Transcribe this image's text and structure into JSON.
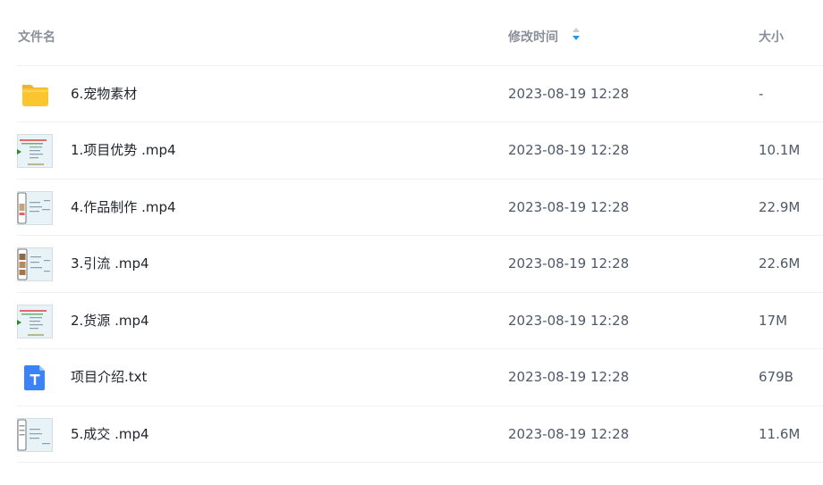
{
  "header": {
    "name_label": "文件名",
    "time_label": "修改时间",
    "size_label": "大小",
    "sort_icon": "sort-icon"
  },
  "colors": {
    "folder": "#fbc531",
    "text_icon": "#3b82f6",
    "sort_active": "#2196f3",
    "divider": "#eef0f3"
  },
  "files": [
    {
      "name": "6.宠物素材",
      "modified": "2023-08-19 12:28",
      "size": "-",
      "icon": "folder-icon"
    },
    {
      "name": "1.项目优势 .mp4",
      "modified": "2023-08-19 12:28",
      "size": "10.1M",
      "icon": "video-thumbnail"
    },
    {
      "name": "4.作品制作 .mp4",
      "modified": "2023-08-19 12:28",
      "size": "22.9M",
      "icon": "video-thumbnail"
    },
    {
      "name": "3.引流 .mp4",
      "modified": "2023-08-19 12:28",
      "size": "22.6M",
      "icon": "video-thumbnail"
    },
    {
      "name": "2.货源 .mp4",
      "modified": "2023-08-19 12:28",
      "size": "17M",
      "icon": "video-thumbnail"
    },
    {
      "name": "项目介绍.txt",
      "modified": "2023-08-19 12:28",
      "size": "679B",
      "icon": "text-file-icon"
    },
    {
      "name": "5.成交 .mp4",
      "modified": "2023-08-19 12:28",
      "size": "11.6M",
      "icon": "video-thumbnail"
    }
  ]
}
